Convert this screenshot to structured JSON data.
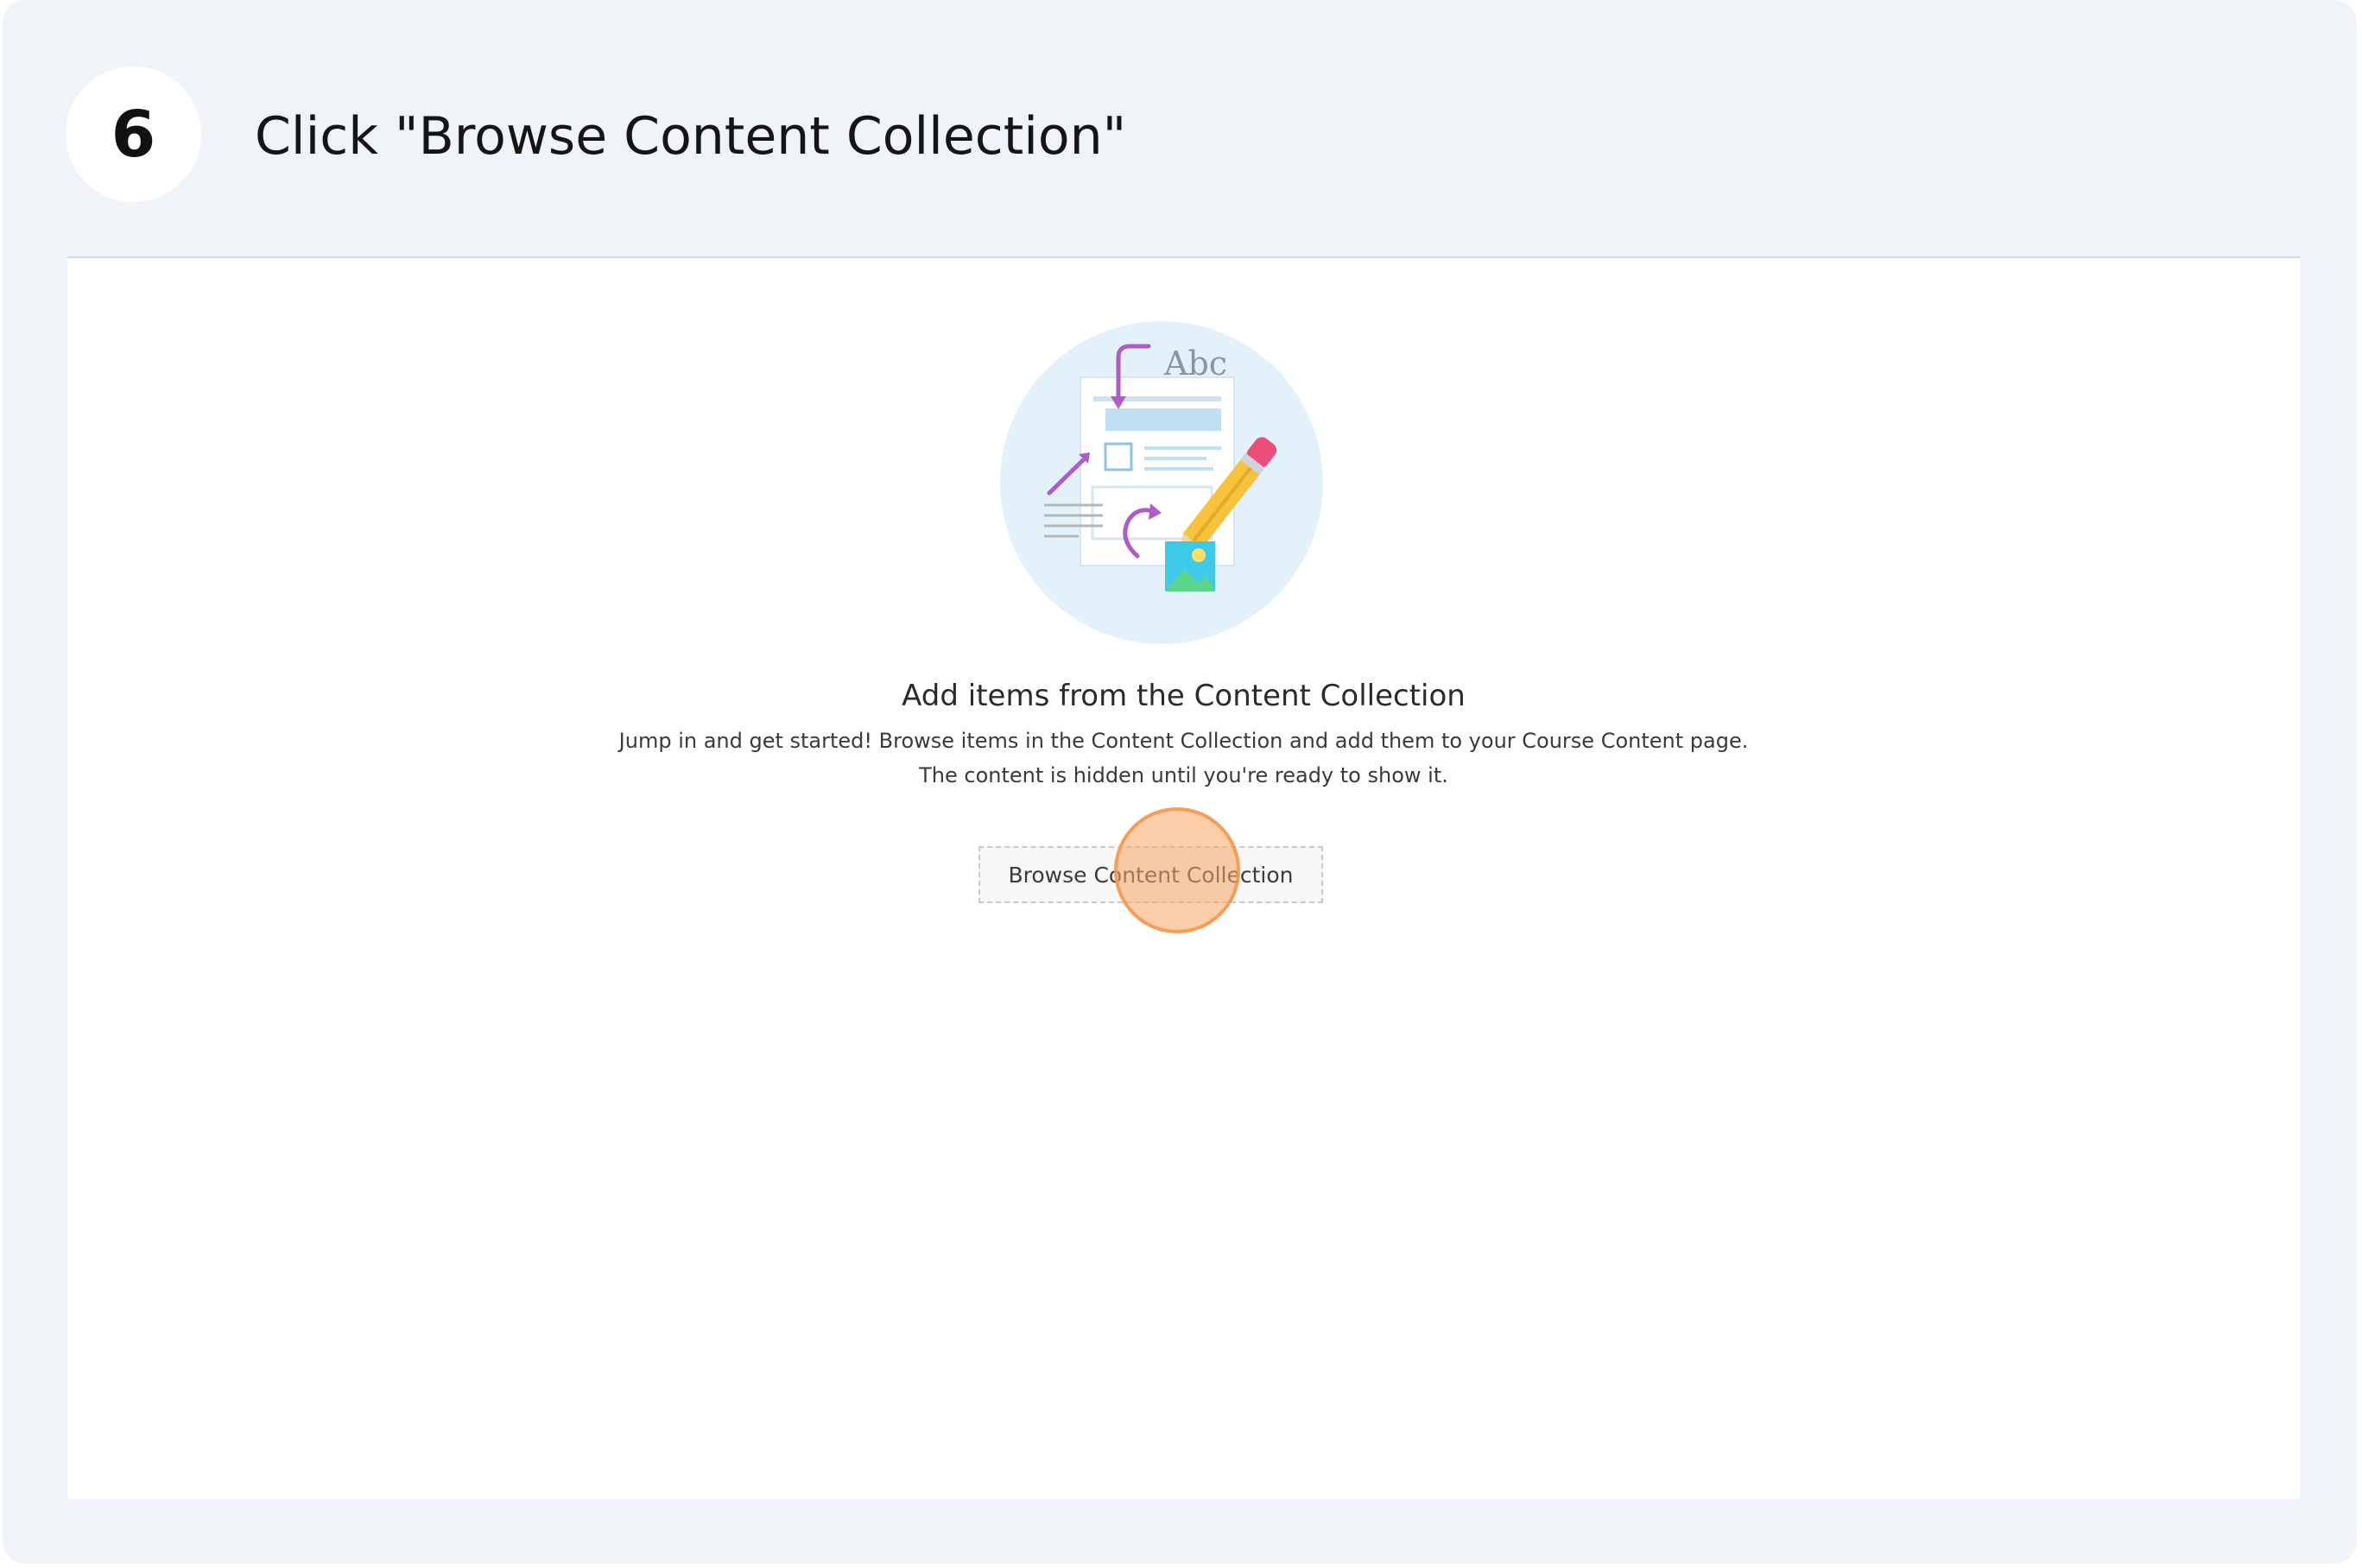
{
  "step": {
    "number": "6",
    "title": "Click \"Browse Content Collection\""
  },
  "empty_state": {
    "illustration_text": "Abc",
    "heading": "Add items from the Content Collection",
    "description_line1": "Jump in and get started! Browse items in the Content Collection and add them to your Course Content page.",
    "description_line2": "The content is hidden until you're ready to show it.",
    "button_label": "Browse Content Collection"
  },
  "colors": {
    "card_background": "#f0f3f8",
    "illustration_circle": "#e3f1fb",
    "accent_purple": "#b05cc7",
    "pencil_yellow": "#f7c23c",
    "pencil_eraser": "#e94f7a",
    "click_highlight": "#f7a460"
  },
  "icons": [
    "document-illustration",
    "pencil-icon",
    "image-icon",
    "arrow-icon"
  ]
}
